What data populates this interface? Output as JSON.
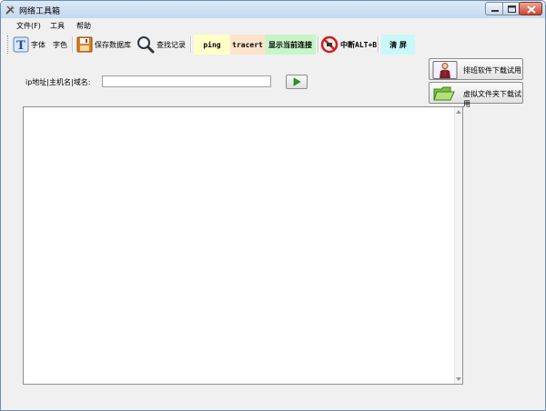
{
  "window": {
    "title": "网络工具箱"
  },
  "menu": [
    "文件(F)",
    "工具",
    "帮助"
  ],
  "toolbar": {
    "font": "字体",
    "color": "字色",
    "save_db": "保存数据库",
    "find_log": "查找记录",
    "ping": "ping",
    "tracert": "tracert",
    "show_conn": "显示当前连接",
    "interrupt": "中断ALT+B",
    "clear": "清 屏"
  },
  "form": {
    "ip_label": "ip地址|主机名|域名:",
    "ip_value": ""
  },
  "side_buttons": [
    "排班软件下载试用",
    "虚拟文件夹下载试用"
  ],
  "colors": {
    "ping_bg": "#ffffc8",
    "tracert_bg": "#fde2cc",
    "show_conn_bg": "#c8f5c8",
    "clear_bg": "#c8f8f8",
    "titlebar": "#c4d9ef"
  }
}
